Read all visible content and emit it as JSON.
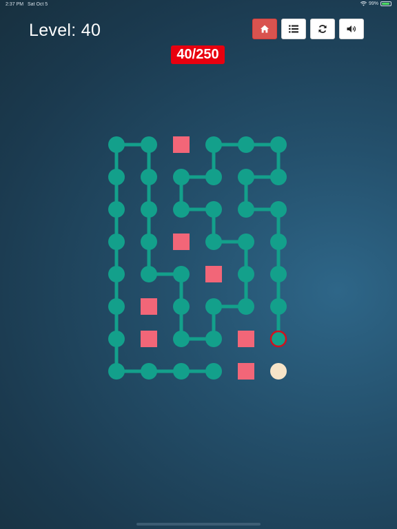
{
  "status_bar": {
    "time": "2:37 PM",
    "date": "Sat Oct 5",
    "battery": "99%"
  },
  "header": {
    "level_text": "Level: 40",
    "progress_text": "40/250"
  },
  "toolbar": [
    {
      "name": "home-button",
      "icon": "home-icon",
      "active": true
    },
    {
      "name": "level-list-button",
      "icon": "list-icon",
      "active": false
    },
    {
      "name": "restart-button",
      "icon": "refresh-icon",
      "active": false
    },
    {
      "name": "sound-button",
      "icon": "speaker-icon",
      "active": false
    }
  ],
  "colors": {
    "path": "#13a08b",
    "blocked": "#f26678",
    "start": "#f7e4c8",
    "current_ring": "#d0101e",
    "badge": "#e8000f",
    "home_button": "#d9534f"
  },
  "board": {
    "cols": 6,
    "rows": 8,
    "blocked_cells": [
      [
        2,
        0
      ],
      [
        2,
        3
      ],
      [
        3,
        4
      ],
      [
        1,
        5
      ],
      [
        1,
        6
      ],
      [
        4,
        6
      ],
      [
        4,
        7
      ]
    ],
    "start_cell": [
      5,
      7
    ],
    "current_cell": [
      5,
      6
    ],
    "path": [
      [
        5,
        6
      ],
      [
        5,
        5
      ],
      [
        5,
        4
      ],
      [
        5,
        3
      ],
      [
        5,
        2
      ],
      [
        4,
        2
      ],
      [
        4,
        1
      ],
      [
        5,
        1
      ],
      [
        5,
        0
      ],
      [
        4,
        0
      ],
      [
        3,
        0
      ],
      [
        3,
        1
      ],
      [
        2,
        1
      ],
      [
        2,
        2
      ],
      [
        3,
        2
      ],
      [
        3,
        3
      ],
      [
        4,
        3
      ],
      [
        4,
        4
      ],
      [
        4,
        5
      ],
      [
        3,
        5
      ],
      [
        3,
        6
      ],
      [
        2,
        6
      ],
      [
        2,
        5
      ],
      [
        2,
        4
      ],
      [
        1,
        4
      ],
      [
        1,
        3
      ],
      [
        1,
        2
      ],
      [
        1,
        1
      ],
      [
        1,
        0
      ],
      [
        0,
        0
      ],
      [
        0,
        1
      ],
      [
        0,
        2
      ],
      [
        0,
        3
      ],
      [
        0,
        4
      ],
      [
        0,
        5
      ],
      [
        0,
        6
      ],
      [
        0,
        7
      ],
      [
        1,
        7
      ],
      [
        2,
        7
      ],
      [
        3,
        7
      ]
    ]
  }
}
